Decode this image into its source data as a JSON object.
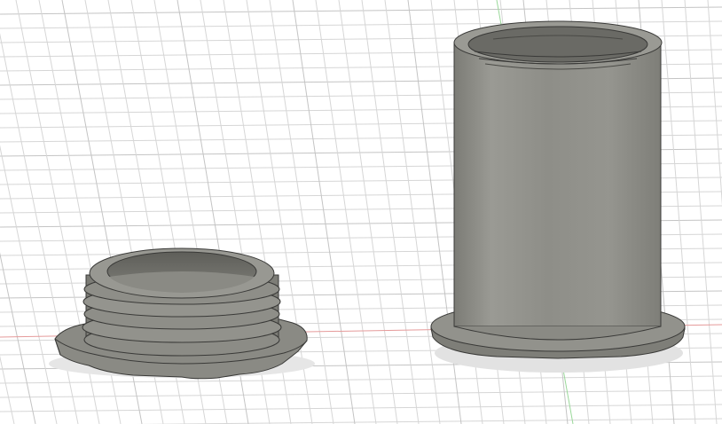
{
  "viewport": {
    "background": "#ffffff",
    "grid_color": "#d6d6d6",
    "grid_major_color": "#c4c4c4",
    "x_axis_color": "#e08a8a",
    "y_axis_color": "#8ad08a"
  },
  "models": [
    {
      "name": "threaded-plug",
      "icon": "threaded-plug-icon",
      "color": "#8a8a84"
    },
    {
      "name": "threaded-sleeve",
      "icon": "threaded-sleeve-icon",
      "color": "#8f8f88"
    }
  ]
}
